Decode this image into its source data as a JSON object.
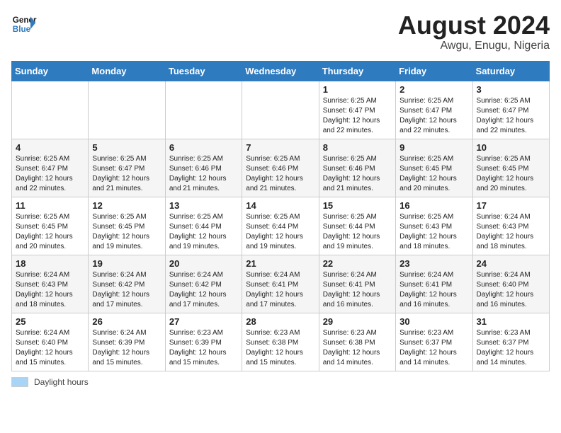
{
  "logo": {
    "line1": "General",
    "line2": "Blue"
  },
  "title": "August 2024",
  "subtitle": "Awgu, Enugu, Nigeria",
  "daylight_label": "Daylight hours",
  "headers": [
    "Sunday",
    "Monday",
    "Tuesday",
    "Wednesday",
    "Thursday",
    "Friday",
    "Saturday"
  ],
  "weeks": [
    [
      {
        "day": "",
        "sunrise": "",
        "sunset": "",
        "daylight": ""
      },
      {
        "day": "",
        "sunrise": "",
        "sunset": "",
        "daylight": ""
      },
      {
        "day": "",
        "sunrise": "",
        "sunset": "",
        "daylight": ""
      },
      {
        "day": "",
        "sunrise": "",
        "sunset": "",
        "daylight": ""
      },
      {
        "day": "1",
        "sunrise": "Sunrise: 6:25 AM",
        "sunset": "Sunset: 6:47 PM",
        "daylight": "Daylight: 12 hours and 22 minutes."
      },
      {
        "day": "2",
        "sunrise": "Sunrise: 6:25 AM",
        "sunset": "Sunset: 6:47 PM",
        "daylight": "Daylight: 12 hours and 22 minutes."
      },
      {
        "day": "3",
        "sunrise": "Sunrise: 6:25 AM",
        "sunset": "Sunset: 6:47 PM",
        "daylight": "Daylight: 12 hours and 22 minutes."
      }
    ],
    [
      {
        "day": "4",
        "sunrise": "Sunrise: 6:25 AM",
        "sunset": "Sunset: 6:47 PM",
        "daylight": "Daylight: 12 hours and 22 minutes."
      },
      {
        "day": "5",
        "sunrise": "Sunrise: 6:25 AM",
        "sunset": "Sunset: 6:47 PM",
        "daylight": "Daylight: 12 hours and 21 minutes."
      },
      {
        "day": "6",
        "sunrise": "Sunrise: 6:25 AM",
        "sunset": "Sunset: 6:46 PM",
        "daylight": "Daylight: 12 hours and 21 minutes."
      },
      {
        "day": "7",
        "sunrise": "Sunrise: 6:25 AM",
        "sunset": "Sunset: 6:46 PM",
        "daylight": "Daylight: 12 hours and 21 minutes."
      },
      {
        "day": "8",
        "sunrise": "Sunrise: 6:25 AM",
        "sunset": "Sunset: 6:46 PM",
        "daylight": "Daylight: 12 hours and 21 minutes."
      },
      {
        "day": "9",
        "sunrise": "Sunrise: 6:25 AM",
        "sunset": "Sunset: 6:45 PM",
        "daylight": "Daylight: 12 hours and 20 minutes."
      },
      {
        "day": "10",
        "sunrise": "Sunrise: 6:25 AM",
        "sunset": "Sunset: 6:45 PM",
        "daylight": "Daylight: 12 hours and 20 minutes."
      }
    ],
    [
      {
        "day": "11",
        "sunrise": "Sunrise: 6:25 AM",
        "sunset": "Sunset: 6:45 PM",
        "daylight": "Daylight: 12 hours and 20 minutes."
      },
      {
        "day": "12",
        "sunrise": "Sunrise: 6:25 AM",
        "sunset": "Sunset: 6:45 PM",
        "daylight": "Daylight: 12 hours and 19 minutes."
      },
      {
        "day": "13",
        "sunrise": "Sunrise: 6:25 AM",
        "sunset": "Sunset: 6:44 PM",
        "daylight": "Daylight: 12 hours and 19 minutes."
      },
      {
        "day": "14",
        "sunrise": "Sunrise: 6:25 AM",
        "sunset": "Sunset: 6:44 PM",
        "daylight": "Daylight: 12 hours and 19 minutes."
      },
      {
        "day": "15",
        "sunrise": "Sunrise: 6:25 AM",
        "sunset": "Sunset: 6:44 PM",
        "daylight": "Daylight: 12 hours and 19 minutes."
      },
      {
        "day": "16",
        "sunrise": "Sunrise: 6:25 AM",
        "sunset": "Sunset: 6:43 PM",
        "daylight": "Daylight: 12 hours and 18 minutes."
      },
      {
        "day": "17",
        "sunrise": "Sunrise: 6:24 AM",
        "sunset": "Sunset: 6:43 PM",
        "daylight": "Daylight: 12 hours and 18 minutes."
      }
    ],
    [
      {
        "day": "18",
        "sunrise": "Sunrise: 6:24 AM",
        "sunset": "Sunset: 6:43 PM",
        "daylight": "Daylight: 12 hours and 18 minutes."
      },
      {
        "day": "19",
        "sunrise": "Sunrise: 6:24 AM",
        "sunset": "Sunset: 6:42 PM",
        "daylight": "Daylight: 12 hours and 17 minutes."
      },
      {
        "day": "20",
        "sunrise": "Sunrise: 6:24 AM",
        "sunset": "Sunset: 6:42 PM",
        "daylight": "Daylight: 12 hours and 17 minutes."
      },
      {
        "day": "21",
        "sunrise": "Sunrise: 6:24 AM",
        "sunset": "Sunset: 6:41 PM",
        "daylight": "Daylight: 12 hours and 17 minutes."
      },
      {
        "day": "22",
        "sunrise": "Sunrise: 6:24 AM",
        "sunset": "Sunset: 6:41 PM",
        "daylight": "Daylight: 12 hours and 16 minutes."
      },
      {
        "day": "23",
        "sunrise": "Sunrise: 6:24 AM",
        "sunset": "Sunset: 6:41 PM",
        "daylight": "Daylight: 12 hours and 16 minutes."
      },
      {
        "day": "24",
        "sunrise": "Sunrise: 6:24 AM",
        "sunset": "Sunset: 6:40 PM",
        "daylight": "Daylight: 12 hours and 16 minutes."
      }
    ],
    [
      {
        "day": "25",
        "sunrise": "Sunrise: 6:24 AM",
        "sunset": "Sunset: 6:40 PM",
        "daylight": "Daylight: 12 hours and 15 minutes."
      },
      {
        "day": "26",
        "sunrise": "Sunrise: 6:24 AM",
        "sunset": "Sunset: 6:39 PM",
        "daylight": "Daylight: 12 hours and 15 minutes."
      },
      {
        "day": "27",
        "sunrise": "Sunrise: 6:23 AM",
        "sunset": "Sunset: 6:39 PM",
        "daylight": "Daylight: 12 hours and 15 minutes."
      },
      {
        "day": "28",
        "sunrise": "Sunrise: 6:23 AM",
        "sunset": "Sunset: 6:38 PM",
        "daylight": "Daylight: 12 hours and 15 minutes."
      },
      {
        "day": "29",
        "sunrise": "Sunrise: 6:23 AM",
        "sunset": "Sunset: 6:38 PM",
        "daylight": "Daylight: 12 hours and 14 minutes."
      },
      {
        "day": "30",
        "sunrise": "Sunrise: 6:23 AM",
        "sunset": "Sunset: 6:37 PM",
        "daylight": "Daylight: 12 hours and 14 minutes."
      },
      {
        "day": "31",
        "sunrise": "Sunrise: 6:23 AM",
        "sunset": "Sunset: 6:37 PM",
        "daylight": "Daylight: 12 hours and 14 minutes."
      }
    ]
  ]
}
